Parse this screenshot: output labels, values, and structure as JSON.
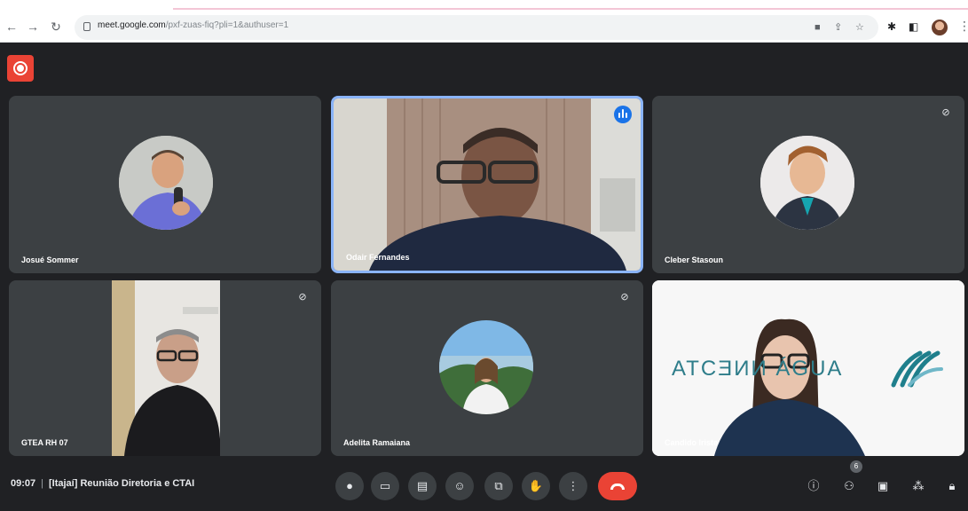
{
  "browser": {
    "url_host": "meet.google.com",
    "url_rest": "/pxf-zuas-fiq?pli=1&authuser=1"
  },
  "participants": [
    {
      "name": "Josué Sommer",
      "muted": false
    },
    {
      "name": "Odair Fernandes",
      "speaking": true
    },
    {
      "name": "Cleber Stasoun",
      "muted": true
    },
    {
      "name": "GTEA RH 07",
      "muted": true
    },
    {
      "name": "Adelita Ramaiana",
      "muted": true
    },
    {
      "name": "Candido Iriste",
      "muted": false
    }
  ],
  "logo_text": "ATCƎИИ ÁGUA",
  "meeting": {
    "time": "09:07",
    "separator": "|",
    "title": "[Itajaí] Reunião Diretoria e CTAI"
  },
  "people_badge": "6",
  "colors": {
    "background": "#202124",
    "tile": "#3c4043",
    "accent": "#8ab4f8",
    "hangup": "#ea4335",
    "record": "#ea4335"
  },
  "icons": {
    "mic": "mic-icon",
    "camera": "camera-icon",
    "captions": "captions-icon",
    "emoji": "emoji-icon",
    "present": "present-icon",
    "hand": "raise-hand-icon",
    "more": "more-options-icon",
    "hangup": "hangup-icon",
    "info": "info-icon",
    "people": "people-icon",
    "chat": "chat-icon",
    "activities": "activities-icon",
    "host": "host-controls-icon"
  }
}
